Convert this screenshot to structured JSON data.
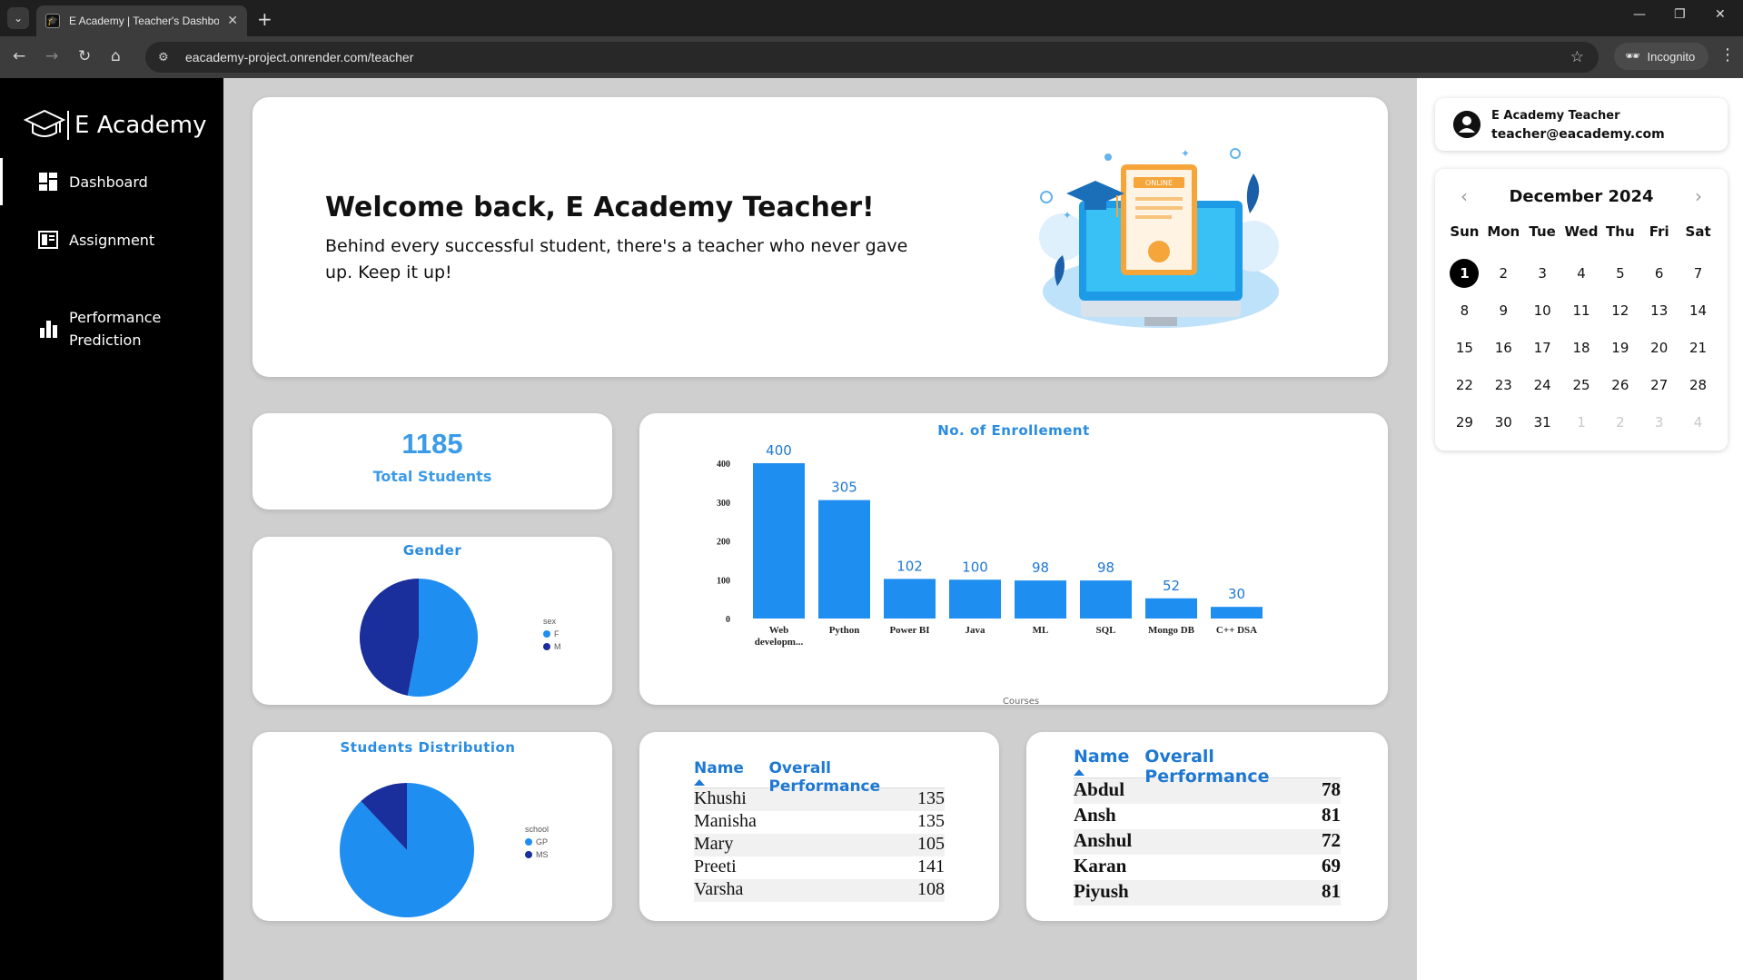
{
  "browser": {
    "tab_title": "E Academy | Teacher's Dashboard",
    "url": "eacademy-project.onrender.com/teacher",
    "incognito_label": "Incognito"
  },
  "sidebar": {
    "brand": "E Academy",
    "items": [
      {
        "label": "Dashboard",
        "icon": "dashboard-icon",
        "active": true
      },
      {
        "label": "Assignment",
        "icon": "assignment-icon",
        "active": false
      },
      {
        "label": "Performance Prediction",
        "icon": "bar-chart-icon",
        "active": false
      }
    ]
  },
  "welcome": {
    "title": "Welcome back, E Academy Teacher!",
    "subtitle": "Behind every successful student, there's a teacher who never gave up. Keep it up!",
    "illustration_badge": "ONLINE"
  },
  "stats": {
    "total_students_value": "1185",
    "total_students_label": "Total Students"
  },
  "gender_chart": {
    "title": "Gender",
    "legend_title": "sex",
    "legend": [
      "F",
      "M"
    ],
    "colors": [
      "#1f8ef1",
      "#1a2e9c"
    ]
  },
  "distribution_chart": {
    "title": "Students Distribution",
    "legend_title": "school",
    "legend": [
      "GP",
      "MS"
    ],
    "colors": [
      "#1f8ef1",
      "#1a2e9c"
    ]
  },
  "chart_data": [
    {
      "type": "bar",
      "title": "No. of Enrollement",
      "xlabel": "Courses",
      "ylabel": "",
      "categories": [
        "Web developm...",
        "Python",
        "Power BI",
        "Java",
        "ML",
        "SQL",
        "Mongo DB",
        "C++ DSA"
      ],
      "values": [
        400,
        305,
        102,
        100,
        98,
        98,
        52,
        30
      ],
      "yticks": [
        0,
        100,
        200,
        300,
        400
      ],
      "ylim": [
        0,
        400
      ],
      "color": "#1f8ef1",
      "grid": false
    },
    {
      "type": "pie",
      "title": "Gender",
      "legend_title": "sex",
      "categories": [
        "F",
        "M"
      ],
      "values": [
        53,
        47
      ]
    },
    {
      "type": "pie",
      "title": "Students Distribution",
      "legend_title": "school",
      "categories": [
        "GP",
        "MS"
      ],
      "values": [
        88,
        12
      ]
    }
  ],
  "table1": {
    "headers": [
      "Name",
      "Overall Performance"
    ],
    "rows": [
      {
        "name": "Khushi",
        "score": "135"
      },
      {
        "name": "Manisha",
        "score": "135"
      },
      {
        "name": "Mary",
        "score": "105"
      },
      {
        "name": "Preeti",
        "score": "141"
      },
      {
        "name": "Varsha",
        "score": "108"
      }
    ]
  },
  "table2": {
    "headers": [
      "Name",
      "Overall Performance"
    ],
    "rows": [
      {
        "name": "Abdul",
        "score": "78"
      },
      {
        "name": "Ansh",
        "score": "81"
      },
      {
        "name": "Anshul",
        "score": "72"
      },
      {
        "name": "Karan",
        "score": "69"
      },
      {
        "name": "Piyush",
        "score": "81"
      }
    ]
  },
  "profile": {
    "name": "E Academy Teacher",
    "email": "teacher@eacademy.com"
  },
  "calendar": {
    "month": "December 2024",
    "weekdays": [
      "Sun",
      "Mon",
      "Tue",
      "Wed",
      "Thu",
      "Fri",
      "Sat"
    ],
    "days": [
      "1",
      "2",
      "3",
      "4",
      "5",
      "6",
      "7",
      "8",
      "9",
      "10",
      "11",
      "12",
      "13",
      "14",
      "15",
      "16",
      "17",
      "18",
      "19",
      "20",
      "21",
      "22",
      "23",
      "24",
      "25",
      "26",
      "27",
      "28",
      "29",
      "30",
      "31"
    ],
    "trailing_days": [
      "1",
      "2",
      "3",
      "4"
    ],
    "selected": "1"
  }
}
